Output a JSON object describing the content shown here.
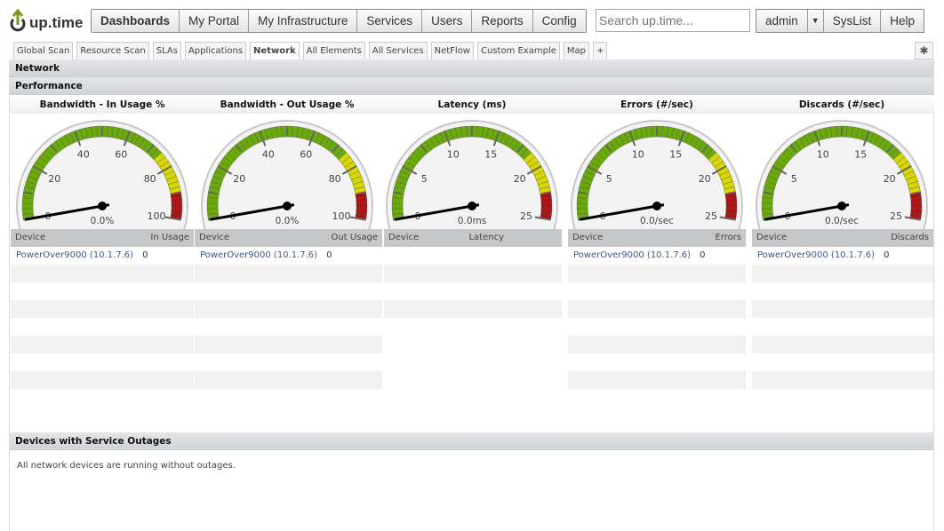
{
  "logo": "up.time",
  "nav": [
    "Dashboards",
    "My Portal",
    "My Infrastructure",
    "Services",
    "Users",
    "Reports",
    "Config"
  ],
  "search_placeholder": "Search up.time...",
  "user_nav": {
    "admin": "admin",
    "syslist": "SysList",
    "help": "Help"
  },
  "tabs": [
    "Global Scan",
    "Resource Scan",
    "SLAs",
    "Applications",
    "Network",
    "All Elements",
    "All Services",
    "NetFlow",
    "Custom Example",
    "Map",
    "+"
  ],
  "section_title": "Network",
  "performance_title": "Performance",
  "gauges": [
    {
      "title": "Bandwidth - In Usage %",
      "max": 100,
      "labels": [
        "0",
        "20",
        "40",
        "60",
        "80",
        "100"
      ],
      "value": 0,
      "readout": "0.0%",
      "col_device": "Device",
      "col_metric": "In Usage",
      "rows": [
        {
          "device": "PowerOver9000 (10.1.7.6)",
          "value": "0"
        }
      ]
    },
    {
      "title": "Bandwidth - Out Usage %",
      "max": 100,
      "labels": [
        "0",
        "20",
        "40",
        "60",
        "80",
        "100"
      ],
      "value": 0,
      "readout": "0.0%",
      "col_device": "Device",
      "col_metric": "Out Usage",
      "rows": [
        {
          "device": "PowerOver9000 (10.1.7.6)",
          "value": "0"
        }
      ]
    },
    {
      "title": "Latency (ms)",
      "max": 25,
      "labels": [
        "0",
        "5",
        "10",
        "15",
        "20",
        "25"
      ],
      "value": 0,
      "readout": "0.0ms",
      "col_device": "Device",
      "col_metric": "Latency",
      "rows": []
    },
    {
      "title": "Errors (#/sec)",
      "max": 25,
      "labels": [
        "0",
        "5",
        "10",
        "15",
        "20",
        "25"
      ],
      "value": 0,
      "readout": "0.0/sec",
      "col_device": "Device",
      "col_metric": "Errors",
      "rows": [
        {
          "device": "PowerOver9000 (10.1.7.6)",
          "value": "0"
        }
      ]
    },
    {
      "title": "Discards (#/sec)",
      "max": 25,
      "labels": [
        "0",
        "5",
        "10",
        "15",
        "20",
        "25"
      ],
      "value": 0,
      "readout": "0.0/sec",
      "col_device": "Device",
      "col_metric": "Discards",
      "rows": [
        {
          "device": "PowerOver9000 (10.1.7.6)",
          "value": "0"
        }
      ]
    }
  ],
  "outages": {
    "title": "Devices with Service Outages",
    "message": "All network devices are running without outages."
  },
  "colors": {
    "green": "#6aaa0a",
    "yellow": "#d8d800",
    "red": "#b01010"
  }
}
